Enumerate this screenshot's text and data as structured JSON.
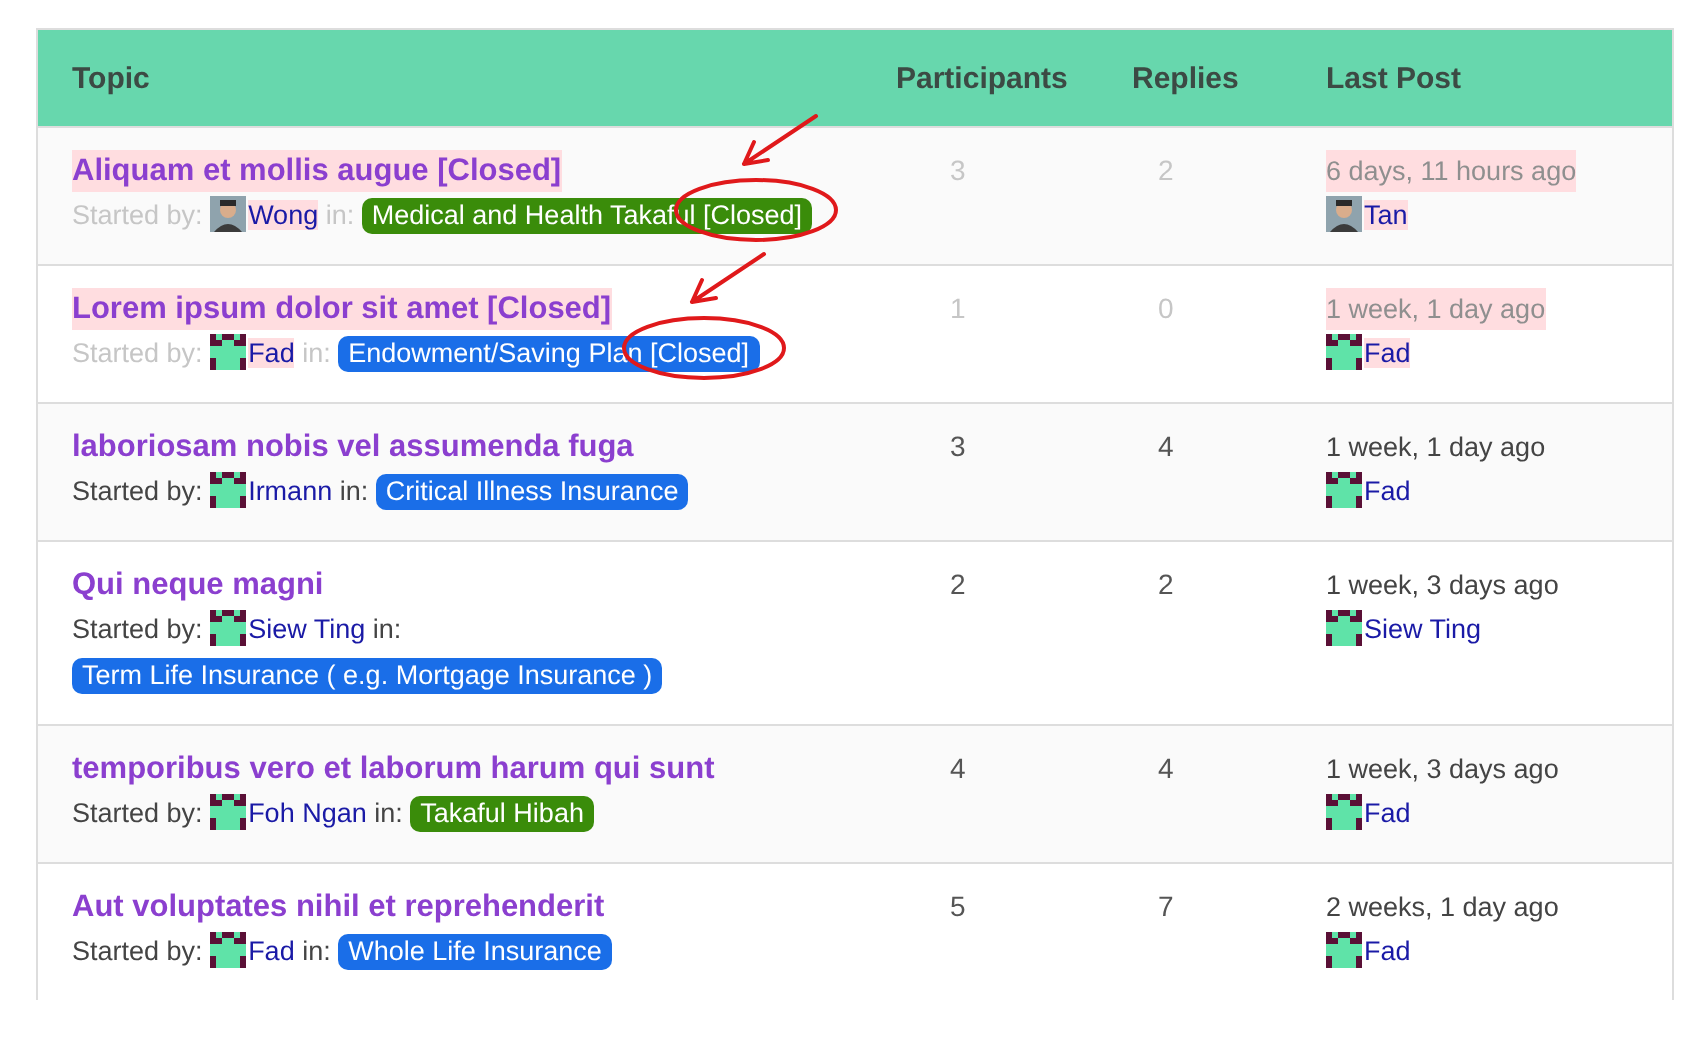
{
  "columns": [
    "Topic",
    "Participants",
    "Replies",
    "Last Post"
  ],
  "topics": [
    {
      "title": "Aliquam et mollis augue [Closed]",
      "closed": true,
      "annotated": true,
      "started_label": "Started by:",
      "author": {
        "name": "Wong",
        "avatar": {
          "kind": "photo"
        }
      },
      "in_label": "in:",
      "forum": {
        "name": "Medical and Health Takaful [Closed]",
        "color": "#3a8c0a"
      },
      "participants": "3",
      "replies": "2",
      "last_post": {
        "time": "6 days, 11 hours ago",
        "user": "Tan",
        "avatar": {
          "kind": "photo"
        }
      }
    },
    {
      "title": "Lorem ipsum dolor sit amet [Closed]",
      "closed": true,
      "annotated": true,
      "started_label": "Started by:",
      "author": {
        "name": "Fad",
        "avatar": {
          "kind": "identicon"
        }
      },
      "in_label": "in:",
      "forum": {
        "name": "Endowment/Saving Plan [Closed]",
        "color": "#1a6ee8"
      },
      "participants": "1",
      "replies": "0",
      "last_post": {
        "time": "1 week, 1 day ago",
        "user": "Fad",
        "avatar": {
          "kind": "identicon"
        }
      }
    },
    {
      "title": "laboriosam nobis vel assumenda fuga",
      "closed": false,
      "annotated": false,
      "started_label": "Started by:",
      "author": {
        "name": "Irmann",
        "avatar": {
          "kind": "identicon"
        }
      },
      "in_label": "in:",
      "forum": {
        "name": "Critical Illness Insurance",
        "color": "#1a6ee8"
      },
      "participants": "3",
      "replies": "4",
      "last_post": {
        "time": "1 week, 1 day ago",
        "user": "Fad",
        "avatar": {
          "kind": "identicon"
        }
      }
    },
    {
      "title": "Qui neque magni",
      "closed": false,
      "annotated": false,
      "started_label": "Started by:",
      "author": {
        "name": "Siew Ting",
        "avatar": {
          "kind": "identicon"
        }
      },
      "in_label": "in:",
      "forum": {
        "name": "Term Life Insurance ( e.g. Mortgage Insurance )",
        "color": "#1a6ee8"
      },
      "participants": "2",
      "replies": "2",
      "last_post": {
        "time": "1 week, 3 days ago",
        "user": "Siew Ting",
        "avatar": {
          "kind": "identicon"
        }
      }
    },
    {
      "title": "temporibus vero et laborum harum qui sunt",
      "closed": false,
      "annotated": false,
      "started_label": "Started by:",
      "author": {
        "name": "Foh Ngan",
        "avatar": {
          "kind": "identicon"
        }
      },
      "in_label": "in:",
      "forum": {
        "name": "Takaful Hibah",
        "color": "#3a8c0a"
      },
      "participants": "4",
      "replies": "4",
      "last_post": {
        "time": "1 week, 3 days ago",
        "user": "Fad",
        "avatar": {
          "kind": "identicon"
        }
      }
    },
    {
      "title": "Aut voluptates nihil et reprehenderit",
      "closed": false,
      "annotated": false,
      "started_label": "Started by:",
      "author": {
        "name": "Fad",
        "avatar": {
          "kind": "identicon"
        }
      },
      "in_label": "in:",
      "forum": {
        "name": "Whole Life Insurance",
        "color": "#1a6ee8"
      },
      "participants": "5",
      "replies": "7",
      "last_post": {
        "time": "2 weeks, 1 day ago",
        "user": "Fad",
        "avatar": {
          "kind": "identicon"
        }
      }
    }
  ]
}
